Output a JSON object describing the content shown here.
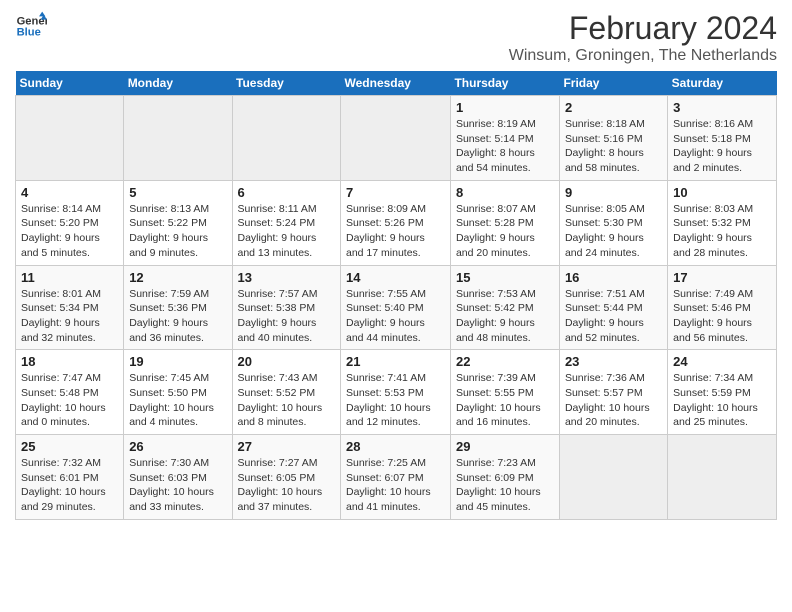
{
  "logo": {
    "line1": "General",
    "line2": "Blue"
  },
  "title": "February 2024",
  "subtitle": "Winsum, Groningen, The Netherlands",
  "weekdays": [
    "Sunday",
    "Monday",
    "Tuesday",
    "Wednesday",
    "Thursday",
    "Friday",
    "Saturday"
  ],
  "weeks": [
    [
      {
        "day": "",
        "info": ""
      },
      {
        "day": "",
        "info": ""
      },
      {
        "day": "",
        "info": ""
      },
      {
        "day": "",
        "info": ""
      },
      {
        "day": "1",
        "info": "Sunrise: 8:19 AM\nSunset: 5:14 PM\nDaylight: 8 hours\nand 54 minutes."
      },
      {
        "day": "2",
        "info": "Sunrise: 8:18 AM\nSunset: 5:16 PM\nDaylight: 8 hours\nand 58 minutes."
      },
      {
        "day": "3",
        "info": "Sunrise: 8:16 AM\nSunset: 5:18 PM\nDaylight: 9 hours\nand 2 minutes."
      }
    ],
    [
      {
        "day": "4",
        "info": "Sunrise: 8:14 AM\nSunset: 5:20 PM\nDaylight: 9 hours\nand 5 minutes."
      },
      {
        "day": "5",
        "info": "Sunrise: 8:13 AM\nSunset: 5:22 PM\nDaylight: 9 hours\nand 9 minutes."
      },
      {
        "day": "6",
        "info": "Sunrise: 8:11 AM\nSunset: 5:24 PM\nDaylight: 9 hours\nand 13 minutes."
      },
      {
        "day": "7",
        "info": "Sunrise: 8:09 AM\nSunset: 5:26 PM\nDaylight: 9 hours\nand 17 minutes."
      },
      {
        "day": "8",
        "info": "Sunrise: 8:07 AM\nSunset: 5:28 PM\nDaylight: 9 hours\nand 20 minutes."
      },
      {
        "day": "9",
        "info": "Sunrise: 8:05 AM\nSunset: 5:30 PM\nDaylight: 9 hours\nand 24 minutes."
      },
      {
        "day": "10",
        "info": "Sunrise: 8:03 AM\nSunset: 5:32 PM\nDaylight: 9 hours\nand 28 minutes."
      }
    ],
    [
      {
        "day": "11",
        "info": "Sunrise: 8:01 AM\nSunset: 5:34 PM\nDaylight: 9 hours\nand 32 minutes."
      },
      {
        "day": "12",
        "info": "Sunrise: 7:59 AM\nSunset: 5:36 PM\nDaylight: 9 hours\nand 36 minutes."
      },
      {
        "day": "13",
        "info": "Sunrise: 7:57 AM\nSunset: 5:38 PM\nDaylight: 9 hours\nand 40 minutes."
      },
      {
        "day": "14",
        "info": "Sunrise: 7:55 AM\nSunset: 5:40 PM\nDaylight: 9 hours\nand 44 minutes."
      },
      {
        "day": "15",
        "info": "Sunrise: 7:53 AM\nSunset: 5:42 PM\nDaylight: 9 hours\nand 48 minutes."
      },
      {
        "day": "16",
        "info": "Sunrise: 7:51 AM\nSunset: 5:44 PM\nDaylight: 9 hours\nand 52 minutes."
      },
      {
        "day": "17",
        "info": "Sunrise: 7:49 AM\nSunset: 5:46 PM\nDaylight: 9 hours\nand 56 minutes."
      }
    ],
    [
      {
        "day": "18",
        "info": "Sunrise: 7:47 AM\nSunset: 5:48 PM\nDaylight: 10 hours\nand 0 minutes."
      },
      {
        "day": "19",
        "info": "Sunrise: 7:45 AM\nSunset: 5:50 PM\nDaylight: 10 hours\nand 4 minutes."
      },
      {
        "day": "20",
        "info": "Sunrise: 7:43 AM\nSunset: 5:52 PM\nDaylight: 10 hours\nand 8 minutes."
      },
      {
        "day": "21",
        "info": "Sunrise: 7:41 AM\nSunset: 5:53 PM\nDaylight: 10 hours\nand 12 minutes."
      },
      {
        "day": "22",
        "info": "Sunrise: 7:39 AM\nSunset: 5:55 PM\nDaylight: 10 hours\nand 16 minutes."
      },
      {
        "day": "23",
        "info": "Sunrise: 7:36 AM\nSunset: 5:57 PM\nDaylight: 10 hours\nand 20 minutes."
      },
      {
        "day": "24",
        "info": "Sunrise: 7:34 AM\nSunset: 5:59 PM\nDaylight: 10 hours\nand 25 minutes."
      }
    ],
    [
      {
        "day": "25",
        "info": "Sunrise: 7:32 AM\nSunset: 6:01 PM\nDaylight: 10 hours\nand 29 minutes."
      },
      {
        "day": "26",
        "info": "Sunrise: 7:30 AM\nSunset: 6:03 PM\nDaylight: 10 hours\nand 33 minutes."
      },
      {
        "day": "27",
        "info": "Sunrise: 7:27 AM\nSunset: 6:05 PM\nDaylight: 10 hours\nand 37 minutes."
      },
      {
        "day": "28",
        "info": "Sunrise: 7:25 AM\nSunset: 6:07 PM\nDaylight: 10 hours\nand 41 minutes."
      },
      {
        "day": "29",
        "info": "Sunrise: 7:23 AM\nSunset: 6:09 PM\nDaylight: 10 hours\nand 45 minutes."
      },
      {
        "day": "",
        "info": ""
      },
      {
        "day": "",
        "info": ""
      }
    ]
  ]
}
